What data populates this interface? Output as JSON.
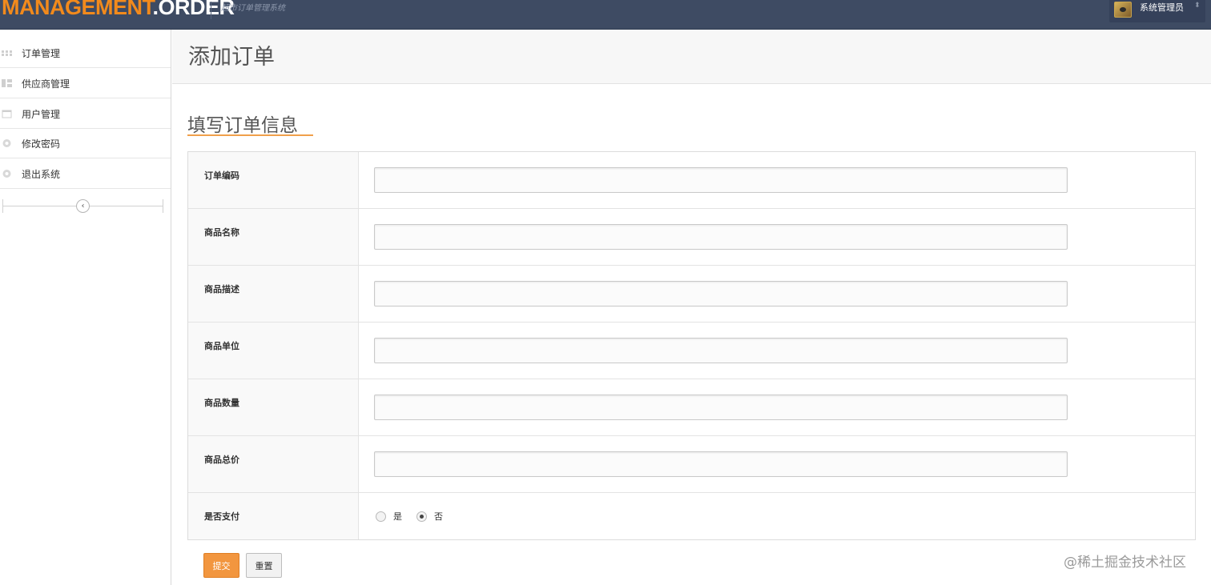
{
  "header": {
    "logo_part1": "MANAGEMENT",
    "logo_part2": ".ORDER",
    "subtitle": "超市订单管理系统",
    "user_name": "系统管理员",
    "user_caret": "⬍"
  },
  "sidebar": {
    "items": [
      {
        "label": "订单管理",
        "icon": "grid-icon"
      },
      {
        "label": "供应商管理",
        "icon": "layout-icon"
      },
      {
        "label": "用户管理",
        "icon": "calendar-icon"
      },
      {
        "label": "修改密码",
        "icon": "settings-icon"
      },
      {
        "label": "退出系统",
        "icon": "settings-icon"
      }
    ],
    "collapse_glyph": "‹"
  },
  "page": {
    "title": "添加订单",
    "section_title": "填写订单信息"
  },
  "form": {
    "fields": [
      {
        "label": "订单编码",
        "value": ""
      },
      {
        "label": "商品名称",
        "value": ""
      },
      {
        "label": "商品描述",
        "value": ""
      },
      {
        "label": "商品单位",
        "value": ""
      },
      {
        "label": "商品数量",
        "value": ""
      },
      {
        "label": "商品总价",
        "value": ""
      }
    ],
    "paid": {
      "label": "是否支付",
      "options": [
        "是",
        "否"
      ],
      "selected": "否"
    },
    "submit_label": "提交",
    "reset_label": "重置"
  },
  "watermark": "@稀土掘金技术社区",
  "colors": {
    "header_bg": "#3e4b63",
    "brand_orange": "#f28a1c",
    "submit_bg": "#f2963f"
  }
}
